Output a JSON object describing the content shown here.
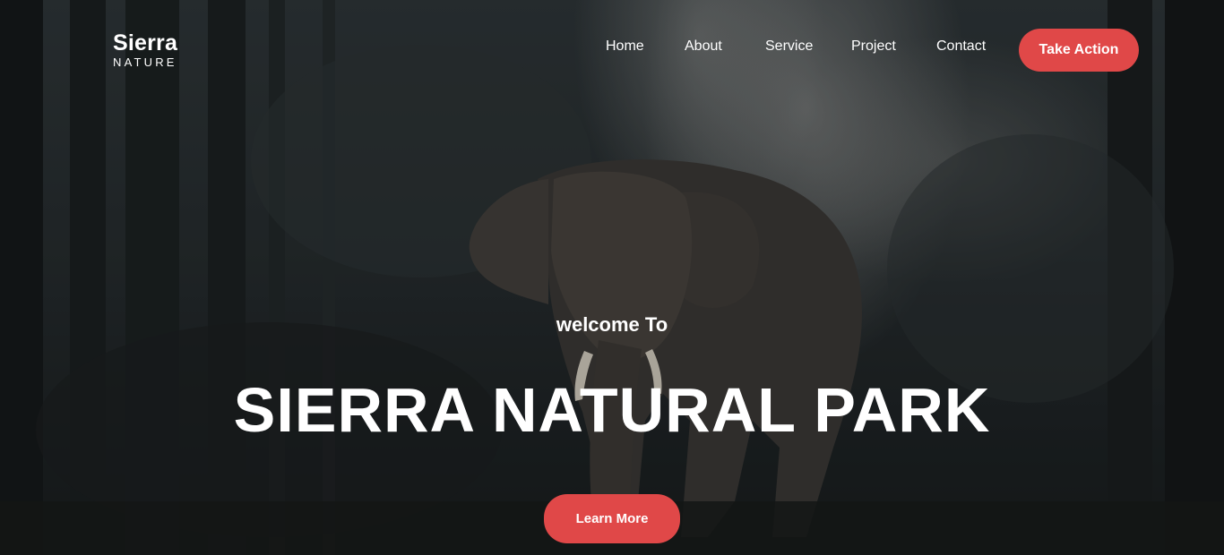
{
  "brand": {
    "name": "Sierra",
    "tagline": "NATURE"
  },
  "nav": {
    "items": [
      {
        "label": "Home"
      },
      {
        "label": "About"
      },
      {
        "label": "Service"
      },
      {
        "label": "Project"
      },
      {
        "label": "Contact"
      }
    ],
    "cta_label": "Take Action"
  },
  "hero": {
    "welcome": "welcome To",
    "title": "SIERRA NATURAL PARK",
    "button_label": "Learn More",
    "background_image": "elephant-in-misty-forest"
  },
  "colors": {
    "accent": "#e04848",
    "text": "#ffffff",
    "background_dark": "#1f2426"
  }
}
